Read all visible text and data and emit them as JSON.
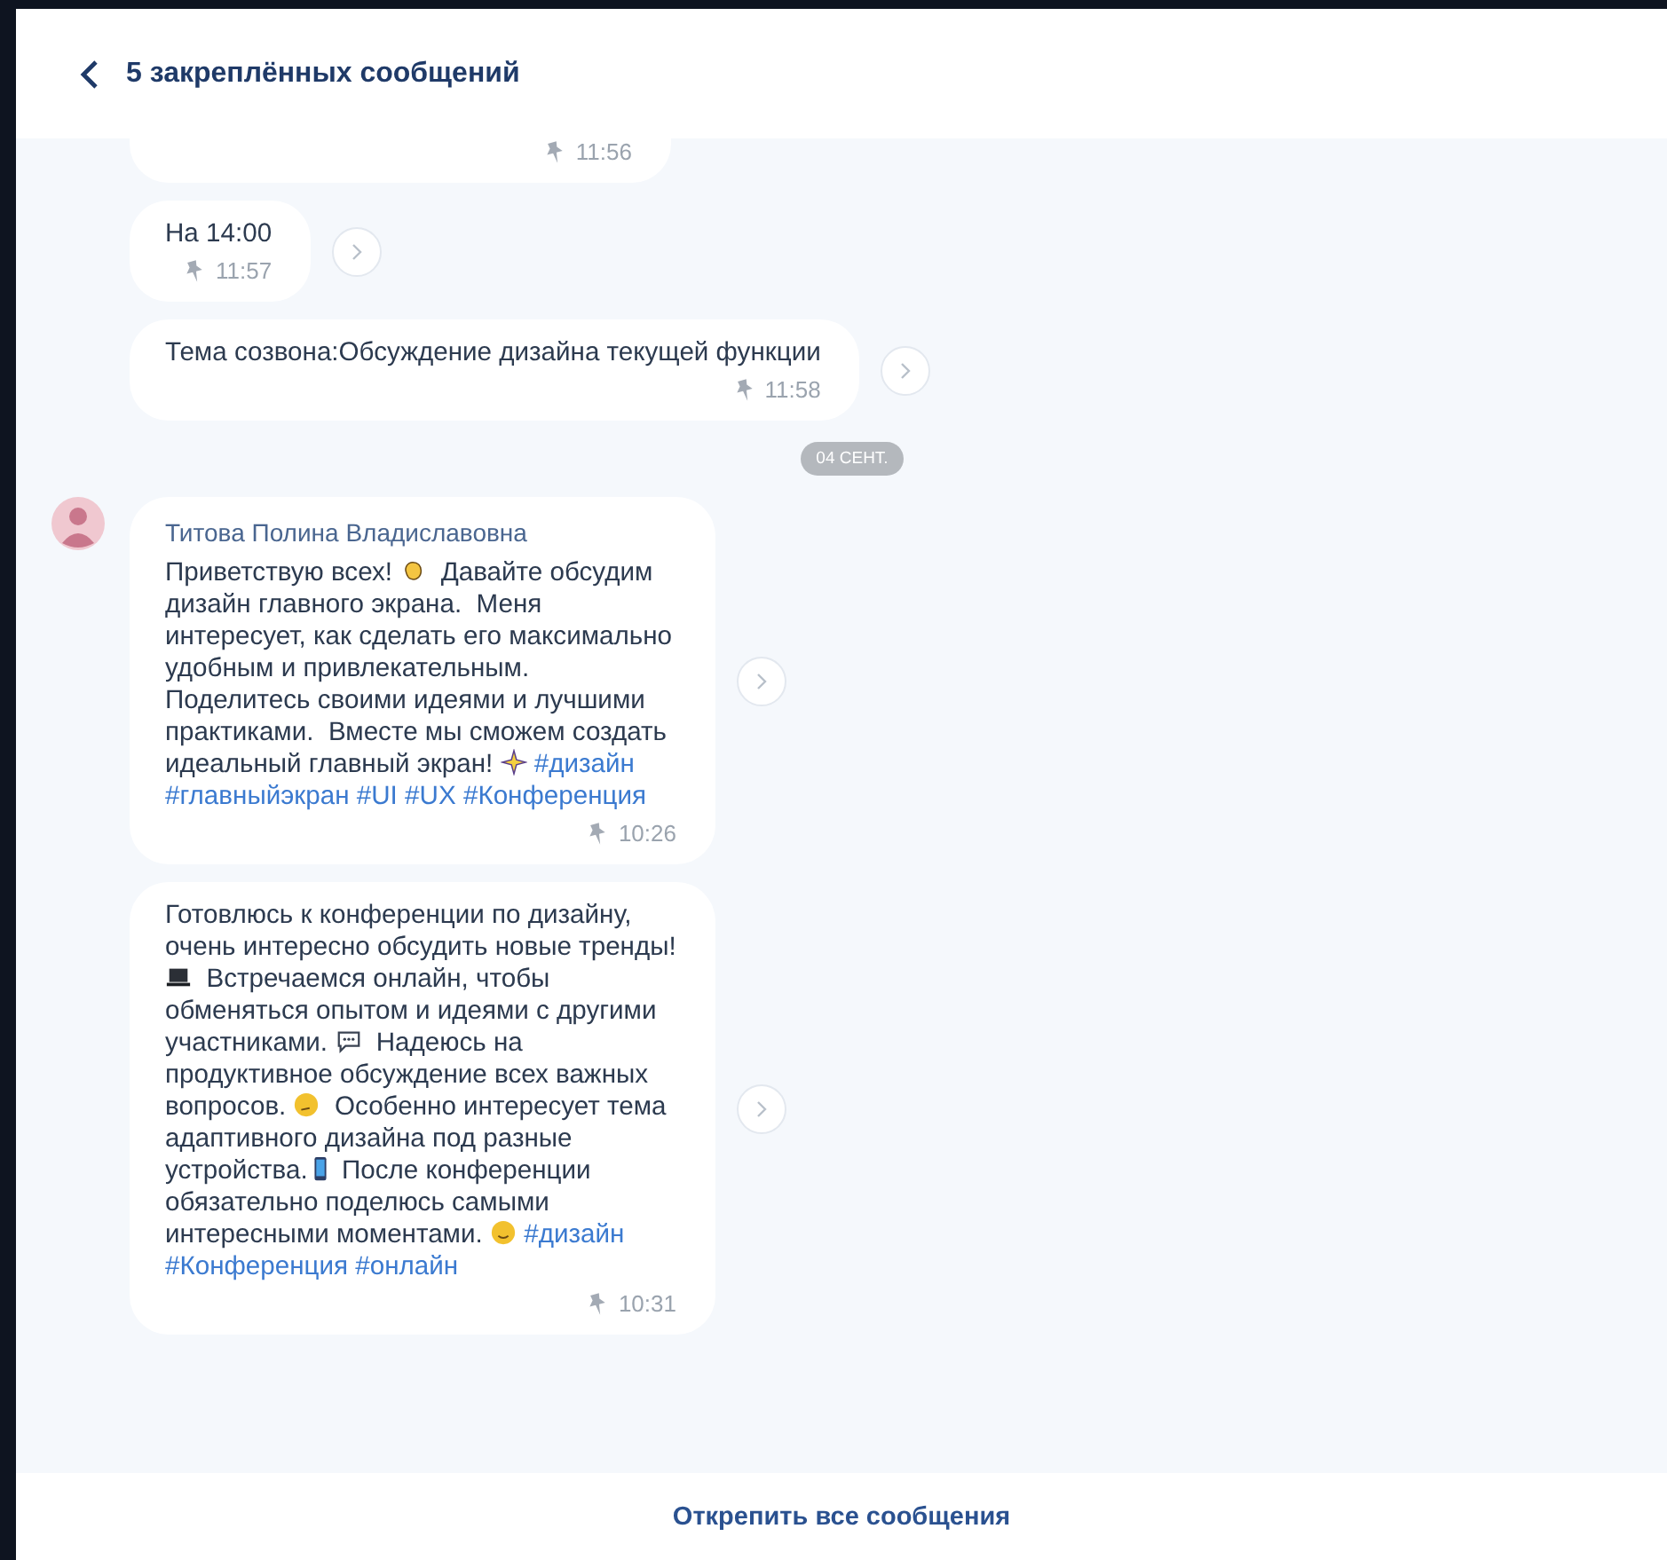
{
  "header": {
    "title": "5 закреплённых сообщений"
  },
  "feed": [
    {
      "kind": "message",
      "time": "11:56"
    },
    {
      "kind": "message",
      "parts": [
        {
          "kind": "text",
          "text": "На 14:00"
        }
      ],
      "time": "11:57"
    },
    {
      "kind": "message",
      "parts": [
        {
          "kind": "text",
          "text": "Тема созвона:Обсуждение дизайна текущей функции"
        }
      ],
      "time": "11:58"
    },
    {
      "kind": "date",
      "text": "04 СЕНТ."
    },
    {
      "kind": "message",
      "author": "Титова Полина Владиславовна",
      "parts": [
        {
          "kind": "text",
          "text": "Приветствую всех! "
        },
        {
          "kind": "hand"
        },
        {
          "kind": "text",
          "text": "  Давайте обсудим дизайн главного экрана.  Меня интересует, как сделать его максимально удобным и привлекательным. Поделитесь своими идеями и лучшими практиками.  Вместе мы сможем создать идеальный главный экран! "
        },
        {
          "kind": "sparkle"
        },
        {
          "kind": "tag",
          "text": "#дизайн"
        },
        {
          "kind": "tag",
          "text": "#главныйэкран"
        },
        {
          "kind": "tag",
          "text": "#UI"
        },
        {
          "kind": "tag",
          "text": "#UX"
        },
        {
          "kind": "tag",
          "text": "#Конференция"
        }
      ],
      "time": "10:26"
    },
    {
      "kind": "message",
      "parts": [
        {
          "kind": "text",
          "text": "Готовлюсь к конференции по дизайну, очень интересно обсудить новые тренды! "
        },
        {
          "kind": "laptop"
        },
        {
          "kind": "text",
          "text": "  Встречаемся онлайн, чтобы обменяться опытом и идеями с другими участниками. "
        },
        {
          "kind": "speech"
        },
        {
          "kind": "text",
          "text": "  Надеюсь на продуктивное обсуждение всех важных вопросов. "
        },
        {
          "kind": "thinking"
        },
        {
          "kind": "text",
          "text": "  Особенно интересует тема адаптивного дизайна под разные устройства."
        },
        {
          "kind": "phone"
        },
        {
          "kind": "text",
          "text": " После конференции обязательно поделюсь самыми интересными моментами. "
        },
        {
          "kind": "wink"
        },
        {
          "kind": "tag",
          "text": "#дизайн"
        },
        {
          "kind": "tag",
          "text": "#Конференция"
        },
        {
          "kind": "tag",
          "text": "#онлайн"
        }
      ],
      "time": "10:31"
    }
  ],
  "footer": {
    "action": "Открепить все сообщения"
  }
}
